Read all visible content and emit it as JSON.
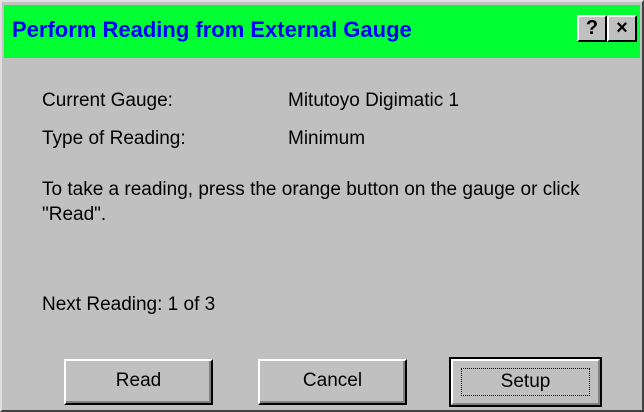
{
  "dialog": {
    "title": "Perform Reading from External Gauge",
    "help_label": "?",
    "close_label": "×"
  },
  "fields": {
    "current_gauge_label": "Current Gauge:",
    "current_gauge_value": "Mitutoyo Digimatic 1",
    "reading_type_label": "Type of Reading:",
    "reading_type_value": "Minimum"
  },
  "instructions": "To take a reading, press the orange button on the gauge or click \"Read\".",
  "next_reading": "Next Reading: 1 of 3",
  "buttons": {
    "read": "Read",
    "cancel": "Cancel",
    "setup": "Setup"
  },
  "colors": {
    "titlebar_bg": "#00ff33",
    "title_text": "#0000ff",
    "dialog_bg": "#c0c0c0"
  }
}
